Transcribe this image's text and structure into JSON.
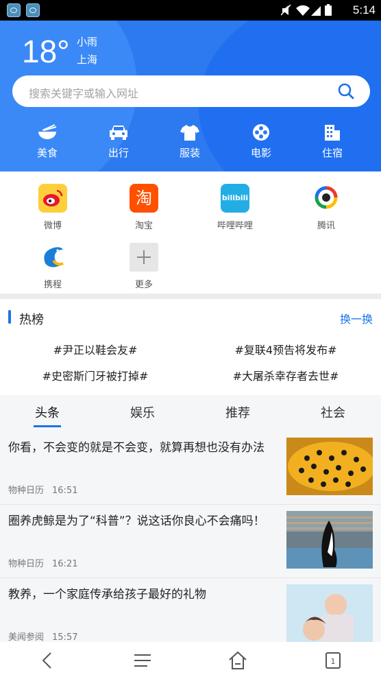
{
  "status_bar": {
    "time": "5:14"
  },
  "weather": {
    "temperature": "18°",
    "condition": "小雨",
    "city": "上海"
  },
  "search": {
    "placeholder": "搜索关键字或输入网址"
  },
  "categories": [
    {
      "label": "美食",
      "icon": "food-bowl-icon"
    },
    {
      "label": "出行",
      "icon": "car-icon"
    },
    {
      "label": "服装",
      "icon": "shirt-icon"
    },
    {
      "label": "电影",
      "icon": "film-reel-icon"
    },
    {
      "label": "住宿",
      "icon": "building-icon"
    }
  ],
  "apps": [
    {
      "label": "微博",
      "icon": "weibo-icon"
    },
    {
      "label": "淘宝",
      "icon": "taobao-icon"
    },
    {
      "label": "哔哩哔哩",
      "icon": "bilibili-icon"
    },
    {
      "label": "腾讯",
      "icon": "tencent-icon"
    },
    {
      "label": "携程",
      "icon": "ctrip-icon"
    },
    {
      "label": "更多",
      "icon": "plus-icon"
    }
  ],
  "hot": {
    "title": "热榜",
    "refresh": "换一换",
    "items": [
      "#尹正以鞋会友#",
      "#复联4预告将发布#",
      "#史密斯门牙被打掉#",
      "#大屠杀幸存者去世#"
    ]
  },
  "news": {
    "tabs": [
      "头条",
      "娱乐",
      "推荐",
      "社会"
    ],
    "active_tab": "头条",
    "items": [
      {
        "title": "你看，不会变的就是不会变，就算再想也没有办法",
        "source": "物种日历",
        "time": "16:51",
        "image": "yellow-spotted-fish"
      },
      {
        "title": "圈养虎鲸是为了“科普”？说这话你良心不会痛吗！",
        "source": "物种日历",
        "time": "16:21",
        "image": "orca-show"
      },
      {
        "title": "教养，一个家庭传承给孩子最好的礼物",
        "source": "美闻参阅",
        "time": "15:57",
        "image": "mother-and-child"
      }
    ]
  },
  "colors": {
    "accent": "#1a73e8",
    "hero": "#2d7af0"
  }
}
